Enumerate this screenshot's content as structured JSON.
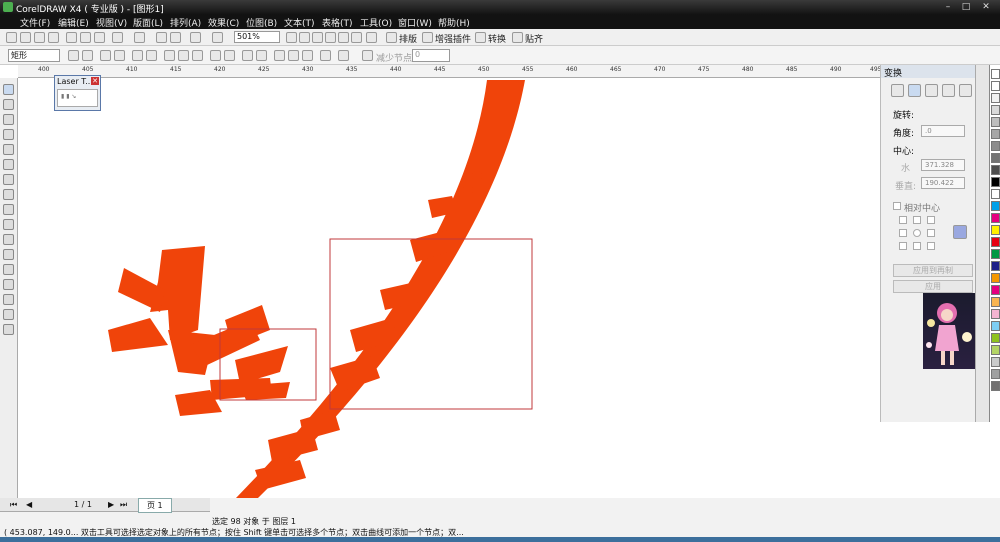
{
  "window": {
    "title": "CorelDRAW X4 ( 专业版 ) - [图形1]"
  },
  "menu": [
    "文件(F)",
    "编辑(E)",
    "视图(V)",
    "版面(L)",
    "排列(A)",
    "效果(C)",
    "位图(B)",
    "文本(T)",
    "表格(T)",
    "工具(O)",
    "窗口(W)",
    "帮助(H)"
  ],
  "toolbar": {
    "zoom": "501%",
    "layout_label": "排版",
    "plugin_label": "增强插件",
    "convert_label": "转换",
    "align_label": "贴齐"
  },
  "propbar": {
    "shape_select": "矩形",
    "reduce_nodes_label": "减少节点",
    "reduce_nodes_value": "0"
  },
  "ruler": {
    "ticks": [
      "400",
      "405",
      "410",
      "415",
      "420",
      "425",
      "430",
      "435",
      "440",
      "445",
      "450",
      "455",
      "460",
      "465",
      "470",
      "475",
      "480",
      "485",
      "490",
      "495"
    ]
  },
  "laser_window": {
    "title": "Laser T..."
  },
  "docker": {
    "title": "变换",
    "rotate_label": "旋转:",
    "angle_label": "角度:",
    "angle_value": ".0",
    "center_label": "中心:",
    "h_label": "水",
    "h_value": "371.328",
    "v_label": "垂直:",
    "v_value": "190.422",
    "relative_center": "相对中心",
    "apply_copy_label": "应用到再制",
    "apply_label": "应用"
  },
  "pagebar": {
    "page_count": "1 / 1",
    "page_tab": "页 1"
  },
  "status": {
    "selection": "选定 98 对象 于 图层 1",
    "hint": "( 453.087, 149.0... 双击工具可选择选定对象上的所有节点；按住 Shift 键单击可选择多个节点；双击曲线可添加一个节点；双..."
  },
  "colors": {
    "shape_fill": "#f0440a",
    "selection_box": "#c0393b",
    "title_bar": "#1e1e1e",
    "menu_bar": "#121212"
  }
}
